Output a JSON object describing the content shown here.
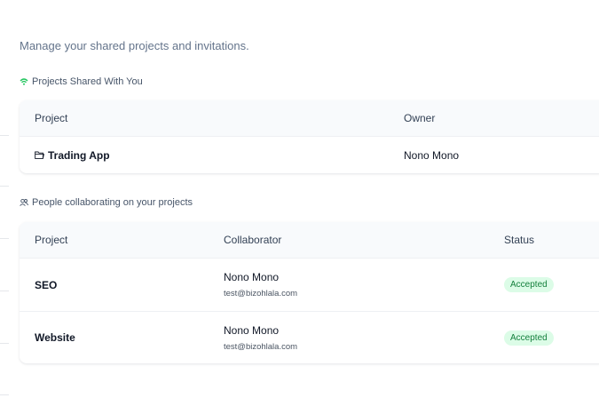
{
  "page": {
    "subtitle": "Manage your shared projects and invitations."
  },
  "shared_with_you": {
    "title": "Projects Shared With You",
    "icon": "wifi-icon",
    "columns": [
      "Project",
      "Owner"
    ],
    "rows": [
      {
        "project": "Trading App",
        "owner": "Nono Mono",
        "icon": "folder-icon"
      }
    ]
  },
  "collaborating": {
    "title": "People collaborating on your projects",
    "icon": "users-icon",
    "columns": [
      "Project",
      "Collaborator",
      "Status"
    ],
    "rows": [
      {
        "project": "SEO",
        "collaborator_name": "Nono Mono",
        "collaborator_email": "test@bizohlala.com",
        "status": "Accepted"
      },
      {
        "project": "Website",
        "collaborator_name": "Nono Mono",
        "collaborator_email": "test@bizohlala.com",
        "status": "Accepted"
      }
    ]
  },
  "colors": {
    "accent": "#22c55e",
    "badge_bg": "#dcfce7",
    "badge_text": "#15803d"
  }
}
